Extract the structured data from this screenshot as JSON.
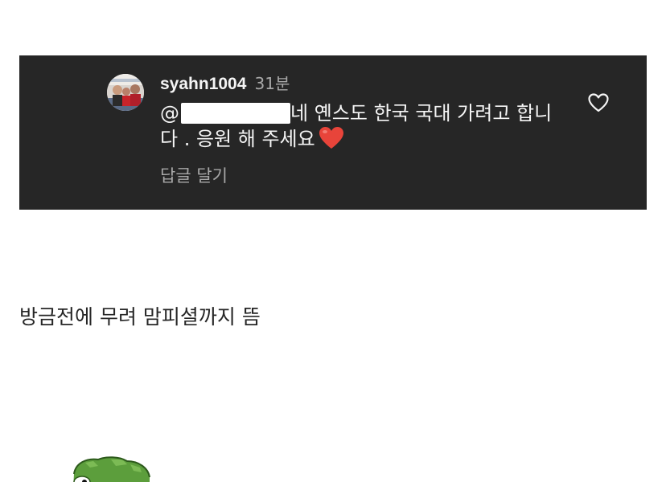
{
  "comment": {
    "username": "syahn1004",
    "timestamp": "31분",
    "mention_prefix": "@",
    "text_line1": "네 옌스도 한국 국대 가려고 합니",
    "text_line2": "다 . 응원 해 주세요",
    "emoji": "heart-emoji",
    "reply_label": "답글 달기",
    "like_icon": "heart-outline-icon",
    "background_color": "#262626"
  },
  "caption": {
    "text": "방금전에 무려 맘피셜까지 뜸"
  },
  "sticker": {
    "icon": "frog-sticker"
  }
}
